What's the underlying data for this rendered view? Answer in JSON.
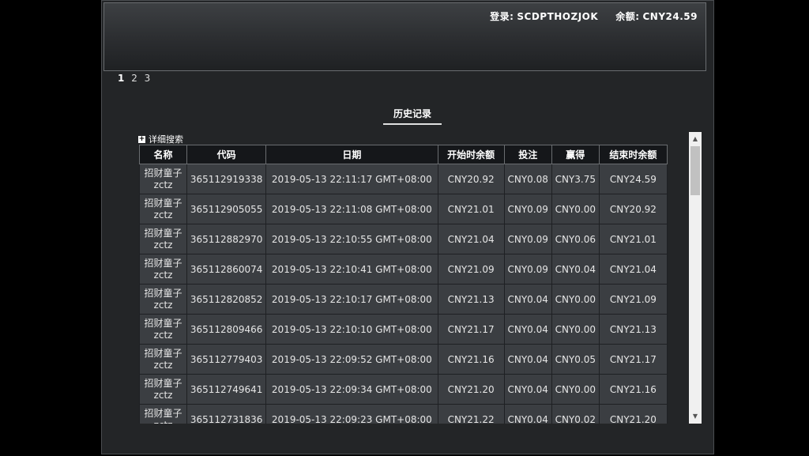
{
  "header": {
    "login_label": "登录:",
    "login_value": "SCDPTHOZJOK",
    "balance_label": "余额:",
    "balance_value": "CNY24.59"
  },
  "pager": {
    "pages": [
      "1",
      "2",
      "3"
    ],
    "active": "1"
  },
  "section_title": "历史记录",
  "search_toggle": "详细搜索",
  "table": {
    "headers": [
      "名称",
      "代码",
      "日期",
      "开始时余额",
      "投注",
      "赢得",
      "结束时余额"
    ],
    "rows": [
      {
        "name": "招财童子",
        "sub": "zctz",
        "code": "365112919338",
        "date": "2019-05-13 22:11:17 GMT+08:00",
        "start": "CNY20.92",
        "bet": "CNY0.08",
        "win": "CNY3.75",
        "end": "CNY24.59"
      },
      {
        "name": "招财童子",
        "sub": "zctz",
        "code": "365112905055",
        "date": "2019-05-13 22:11:08 GMT+08:00",
        "start": "CNY21.01",
        "bet": "CNY0.09",
        "win": "CNY0.00",
        "end": "CNY20.92"
      },
      {
        "name": "招财童子",
        "sub": "zctz",
        "code": "365112882970",
        "date": "2019-05-13 22:10:55 GMT+08:00",
        "start": "CNY21.04",
        "bet": "CNY0.09",
        "win": "CNY0.06",
        "end": "CNY21.01"
      },
      {
        "name": "招财童子",
        "sub": "zctz",
        "code": "365112860074",
        "date": "2019-05-13 22:10:41 GMT+08:00",
        "start": "CNY21.09",
        "bet": "CNY0.09",
        "win": "CNY0.04",
        "end": "CNY21.04"
      },
      {
        "name": "招财童子",
        "sub": "zctz",
        "code": "365112820852",
        "date": "2019-05-13 22:10:17 GMT+08:00",
        "start": "CNY21.13",
        "bet": "CNY0.04",
        "win": "CNY0.00",
        "end": "CNY21.09"
      },
      {
        "name": "招财童子",
        "sub": "zctz",
        "code": "365112809466",
        "date": "2019-05-13 22:10:10 GMT+08:00",
        "start": "CNY21.17",
        "bet": "CNY0.04",
        "win": "CNY0.00",
        "end": "CNY21.13"
      },
      {
        "name": "招财童子",
        "sub": "zctz",
        "code": "365112779403",
        "date": "2019-05-13 22:09:52 GMT+08:00",
        "start": "CNY21.16",
        "bet": "CNY0.04",
        "win": "CNY0.05",
        "end": "CNY21.17"
      },
      {
        "name": "招财童子",
        "sub": "zctz",
        "code": "365112749641",
        "date": "2019-05-13 22:09:34 GMT+08:00",
        "start": "CNY21.20",
        "bet": "CNY0.04",
        "win": "CNY0.00",
        "end": "CNY21.16"
      },
      {
        "name": "招财童子",
        "sub": "zctz",
        "code": "365112731836",
        "date": "2019-05-13 22:09:23 GMT+08:00",
        "start": "CNY21.22",
        "bet": "CNY0.04",
        "win": "CNY0.02",
        "end": "CNY21.20"
      }
    ]
  }
}
